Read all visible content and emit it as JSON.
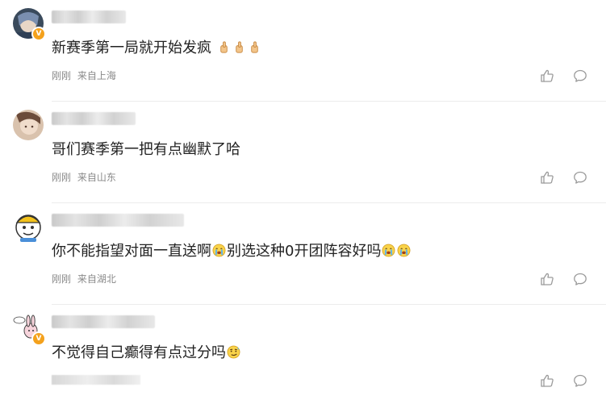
{
  "comments": [
    {
      "text": "新赛季第一局就开始发疯",
      "emojis": [
        "thumb-emoji",
        "thumb-emoji",
        "thumb-emoji"
      ],
      "time": "刚刚",
      "location": "来自上海",
      "verified_badge": "V"
    },
    {
      "text": "哥们赛季第一把有点幽默了哈",
      "time": "刚刚",
      "location": "来自山东"
    },
    {
      "text_part1": "你不能指望对面一直送啊",
      "text_part2": "别选这种0开团阵容好吗",
      "emojis": [
        "crying-emoji",
        "crying-emoji",
        "crying-emoji"
      ],
      "time": "刚刚",
      "location": "来自湖北"
    },
    {
      "text": "不觉得自己癫得有点过分吗",
      "emojis": [
        "smirk-emoji"
      ],
      "verified_badge": "V"
    }
  ],
  "colors": {
    "text": "#222222",
    "meta": "#8a8a8a",
    "badge": "#f4a11c",
    "icon": "#9a9a9a",
    "divider": "#ececec"
  },
  "icons": {
    "like": "thumbs-up-icon",
    "reply": "speech-bubble-icon"
  }
}
